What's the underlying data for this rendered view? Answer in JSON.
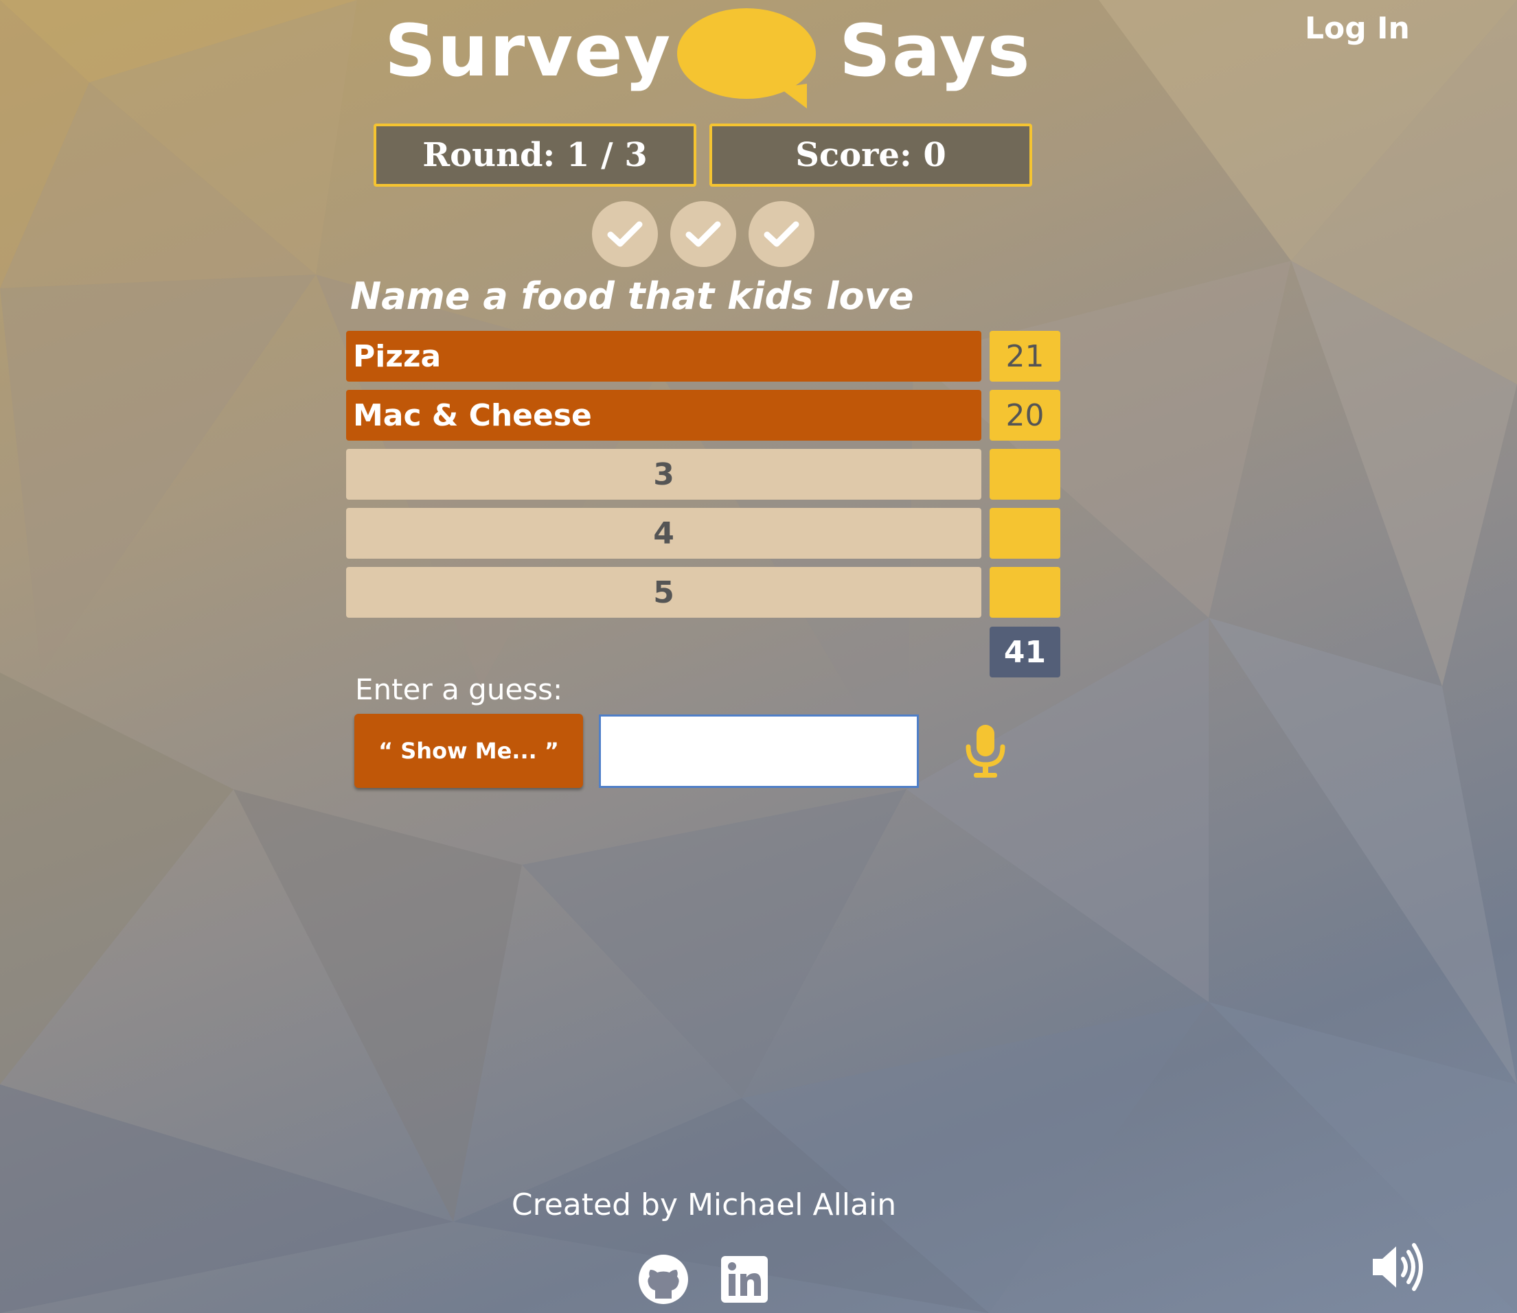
{
  "header": {
    "logo_left": "Survey",
    "logo_right": "Says",
    "login_label": "Log In"
  },
  "status": {
    "round_text": "Round: 1 / 3",
    "score_text": "Score: 0"
  },
  "strikes": [
    {
      "icon": "check-icon"
    },
    {
      "icon": "check-icon"
    },
    {
      "icon": "check-icon"
    }
  ],
  "question": "Name a food that kids love",
  "answers": [
    {
      "text": "Pizza",
      "points": "21",
      "revealed": true
    },
    {
      "text": "Mac & Cheese",
      "points": "20",
      "revealed": true
    },
    {
      "text": "3",
      "points": "",
      "revealed": false
    },
    {
      "text": "4",
      "points": "",
      "revealed": false
    },
    {
      "text": "5",
      "points": "",
      "revealed": false
    }
  ],
  "total": "41",
  "guess": {
    "label": "Enter a guess:",
    "button_label": "“ Show Me... ”",
    "input_value": "",
    "mic_icon": "microphone-icon"
  },
  "footer": {
    "credit": "Created by Michael Allain",
    "github_icon": "github-icon",
    "linkedin_icon": "linkedin-icon",
    "sound_icon": "speaker-volume-icon"
  },
  "colors": {
    "accent_yellow": "#f5c431",
    "revealed_orange": "#c05708",
    "hidden_tan": "#dfc9aa",
    "total_slate": "#545f78",
    "info_box_bg": "#716958"
  }
}
